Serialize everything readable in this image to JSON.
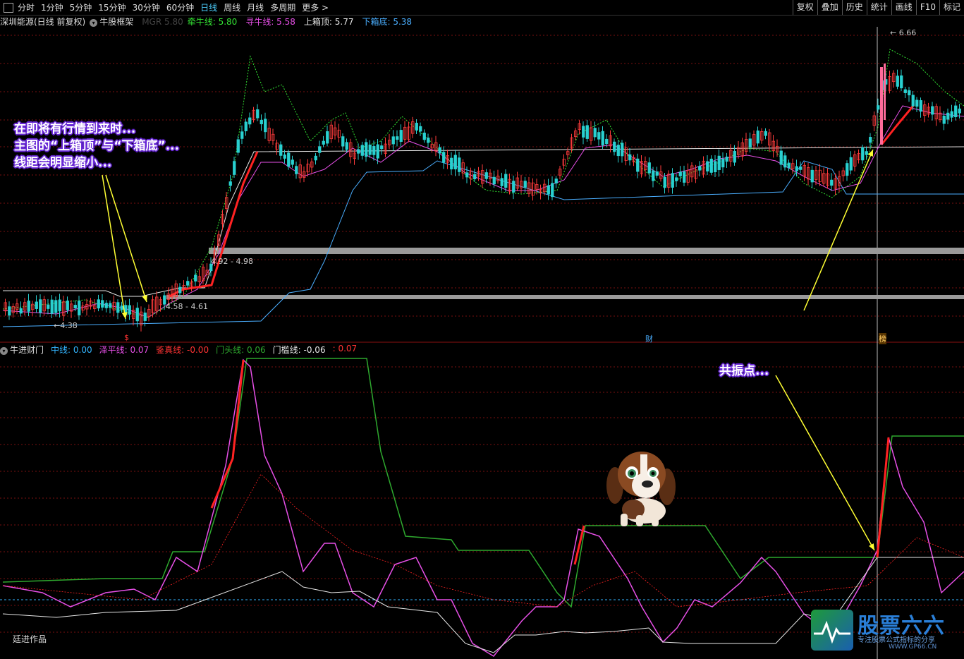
{
  "toolbar": {
    "periods": [
      "分时",
      "1分钟",
      "5分钟",
      "15分钟",
      "30分钟",
      "60分钟",
      "日线",
      "周线",
      "月线",
      "多周期",
      "更多 >"
    ],
    "active_period": "日线",
    "right_buttons": [
      "复权",
      "叠加",
      "历史",
      "统计",
      "画线",
      "F10",
      "标记"
    ]
  },
  "main_legend": {
    "stock": "深圳能源(日线 前复权)",
    "indicator": "牛股框架",
    "faded": "MGR 5.80",
    "items": [
      {
        "label": "牵牛线: 5.80",
        "color": "#33e533"
      },
      {
        "label": "寻牛线: 5.58",
        "color": "#e64fe6"
      },
      {
        "label": "上箱顶: 5.77",
        "color": "#e8e8e8"
      },
      {
        "label": "下箱底: 5.38",
        "color": "#4aaeff"
      }
    ]
  },
  "sub_legend": {
    "indicator": "牛进财门",
    "items": [
      {
        "label": "中线: 0.00",
        "color": "#33b5ff"
      },
      {
        "label": "泽平线: 0.07",
        "color": "#e64fe6"
      },
      {
        "label": "鉴真线: -0.00",
        "color": "#ff3333"
      },
      {
        "label": "门头线: 0.06",
        "color": "#2ea82e"
      },
      {
        "label": "门槛线: -0.06",
        "color": "#e8e8e8"
      },
      {
        "label": ": 0.07",
        "color": "#ff3333"
      }
    ]
  },
  "price_labels": {
    "high": "6.66",
    "low": "4.38",
    "range1": "4.92 - 4.98",
    "range2": "4.58 - 4.61"
  },
  "markers": {
    "dollar": "$",
    "cai": "财",
    "bang": "榜"
  },
  "callouts": {
    "top_lines": [
      "在即将有行情到来时...",
      "主图的“上箱顶”与“下箱底”...",
      "线距会明显缩小..."
    ],
    "resonance": "共振点..."
  },
  "footer": {
    "author": "廷进作品"
  },
  "watermark": {
    "title": "股票六六",
    "subtitle": "专注股票公式指标的分享",
    "url": "WWW.GP66.CN"
  },
  "colors": {
    "up": "#ff3b3b",
    "down": "#29d0d0",
    "box_top": "#e8e8e8",
    "box_bottom": "#4aaeff",
    "magenta": "#e64fe6",
    "green_dotted": "#33e533",
    "callout_bg": "#6a2bd6",
    "arrow": "#ffff33"
  }
}
